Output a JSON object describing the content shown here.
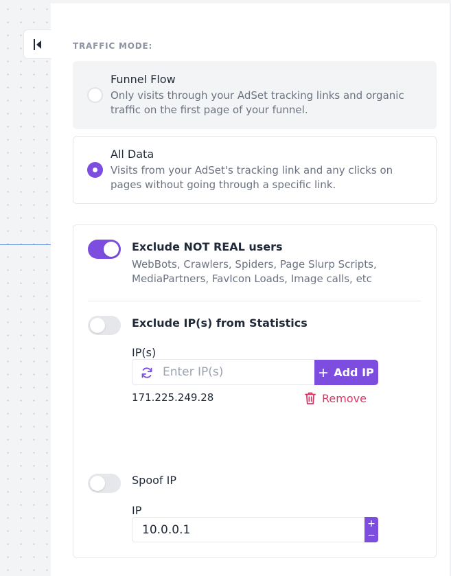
{
  "traffic_mode": {
    "label": "TRAFFIC MODE:",
    "options": [
      {
        "title": "Funnel Flow",
        "description": "Only visits through your AdSet tracking links and organic traffic on the first page of your funnel.",
        "selected": false
      },
      {
        "title": "All Data",
        "description": "Visits from your AdSet's tracking link and any clicks on pages without going through a specific link.",
        "selected": true
      }
    ]
  },
  "exclude_bots": {
    "title": "Exclude NOT REAL users",
    "description": "WebBots, Crawlers, Spiders, Page Slurp Scripts, MediaPartners, FavIcon Loads, Image calls, etc",
    "enabled": true
  },
  "exclude_ips": {
    "title": "Exclude IP(s) from Statistics",
    "enabled": false,
    "field_label": "IP(s)",
    "placeholder": "Enter IP(s)",
    "add_label": "Add IP",
    "ips": [
      "171.225.249.28"
    ],
    "remove_label": "Remove"
  },
  "spoof_ip": {
    "title": "Spoof IP",
    "enabled": false,
    "field_label": "IP",
    "value": "10.0.0.1",
    "increment": "+",
    "decrement": "−"
  },
  "colors": {
    "accent": "#7c4ddf",
    "danger": "#d63865"
  },
  "icons": {
    "collapse": "collapse-left-icon",
    "refresh": "refresh-icon",
    "add": "plus-icon",
    "remove": "trash-icon"
  }
}
